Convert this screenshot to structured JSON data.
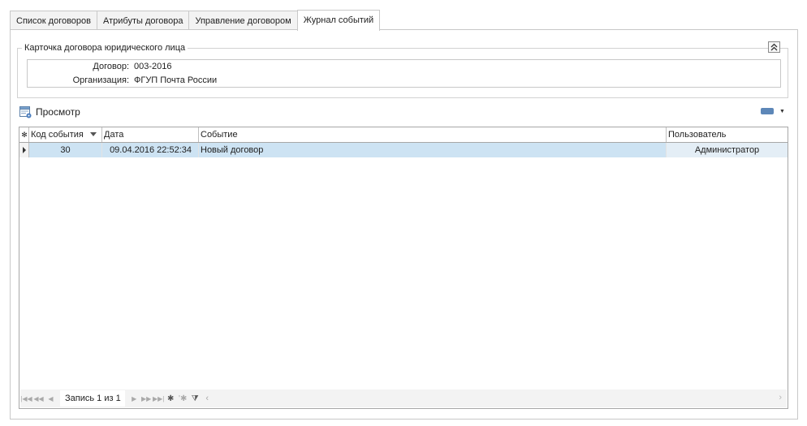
{
  "tabs": [
    {
      "label": "Список договоров",
      "active": false
    },
    {
      "label": "Атрибуты договора",
      "active": false
    },
    {
      "label": "Управление договором",
      "active": false
    },
    {
      "label": "Журнал событий",
      "active": true
    }
  ],
  "card": {
    "title": "Карточка договора юридического лица",
    "collapse_icon": "chevron-double-up",
    "fields": [
      {
        "label": "Договор:",
        "value": "003-2016"
      },
      {
        "label": "Организация:",
        "value": "ФГУП Почта России"
      }
    ]
  },
  "toolbar": {
    "view_label": "Просмотр",
    "view_icon": "table-view-icon",
    "layout_icon": "layout-icon",
    "accent": "#5d87b8"
  },
  "grid": {
    "indicator_header": "✻",
    "columns": [
      "Код события",
      "Дата",
      "Событие",
      "Пользователь"
    ],
    "rows": [
      {
        "code": "30",
        "date": "09.04.2016 22:52:34",
        "event": "Новый договор",
        "user": "Администратор"
      }
    ],
    "selected_row_color": "#cde3f3"
  },
  "navigator": {
    "record_info": "Запись 1 из 1",
    "buttons": [
      "first",
      "prev-page",
      "prev",
      "next",
      "next-page",
      "last",
      "append",
      "delete",
      "filter"
    ]
  }
}
